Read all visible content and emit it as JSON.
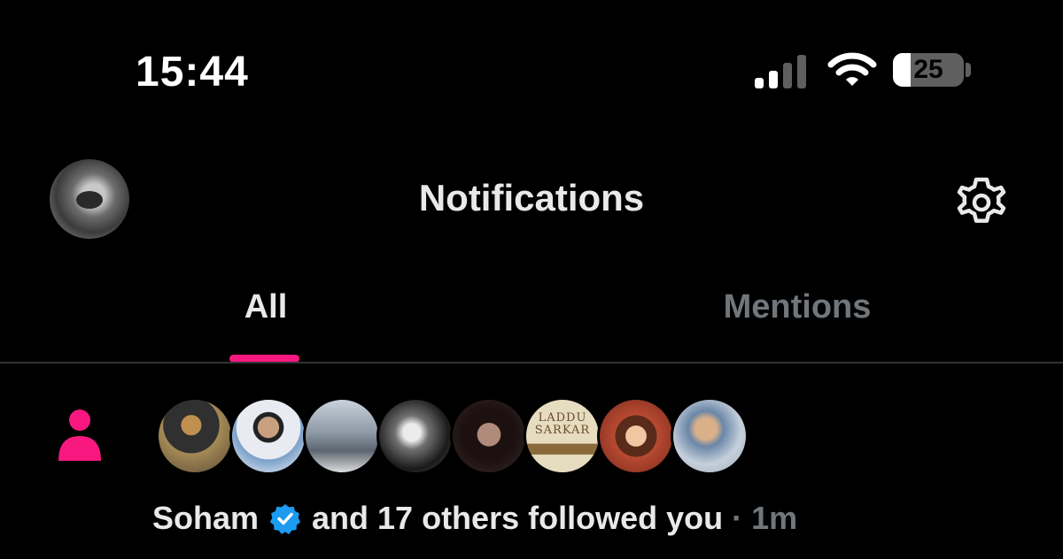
{
  "status_bar": {
    "time": "15:44",
    "battery_level": "25",
    "battery_percent": 25,
    "signal_icon": "cellular-signal-icon",
    "wifi_icon": "wifi-icon"
  },
  "header": {
    "title": "Notifications",
    "avatar_icon": "profile-avatar",
    "settings_icon": "gear-icon"
  },
  "tabs": [
    {
      "label": "All",
      "active": true
    },
    {
      "label": "Mentions",
      "active": false
    }
  ],
  "notification": {
    "type_icon": "person-follow-icon",
    "user_name": "Soham",
    "verified": true,
    "text": "and 17 others followed you",
    "separator": "·",
    "time_ago": "1m",
    "avatar_6_text": "LADDU SARKAR"
  },
  "colors": {
    "accent": "#f91880",
    "verified": "#1d9bf0",
    "muted": "#71767b",
    "primary_text": "#e7e9ea",
    "background": "#000000"
  }
}
